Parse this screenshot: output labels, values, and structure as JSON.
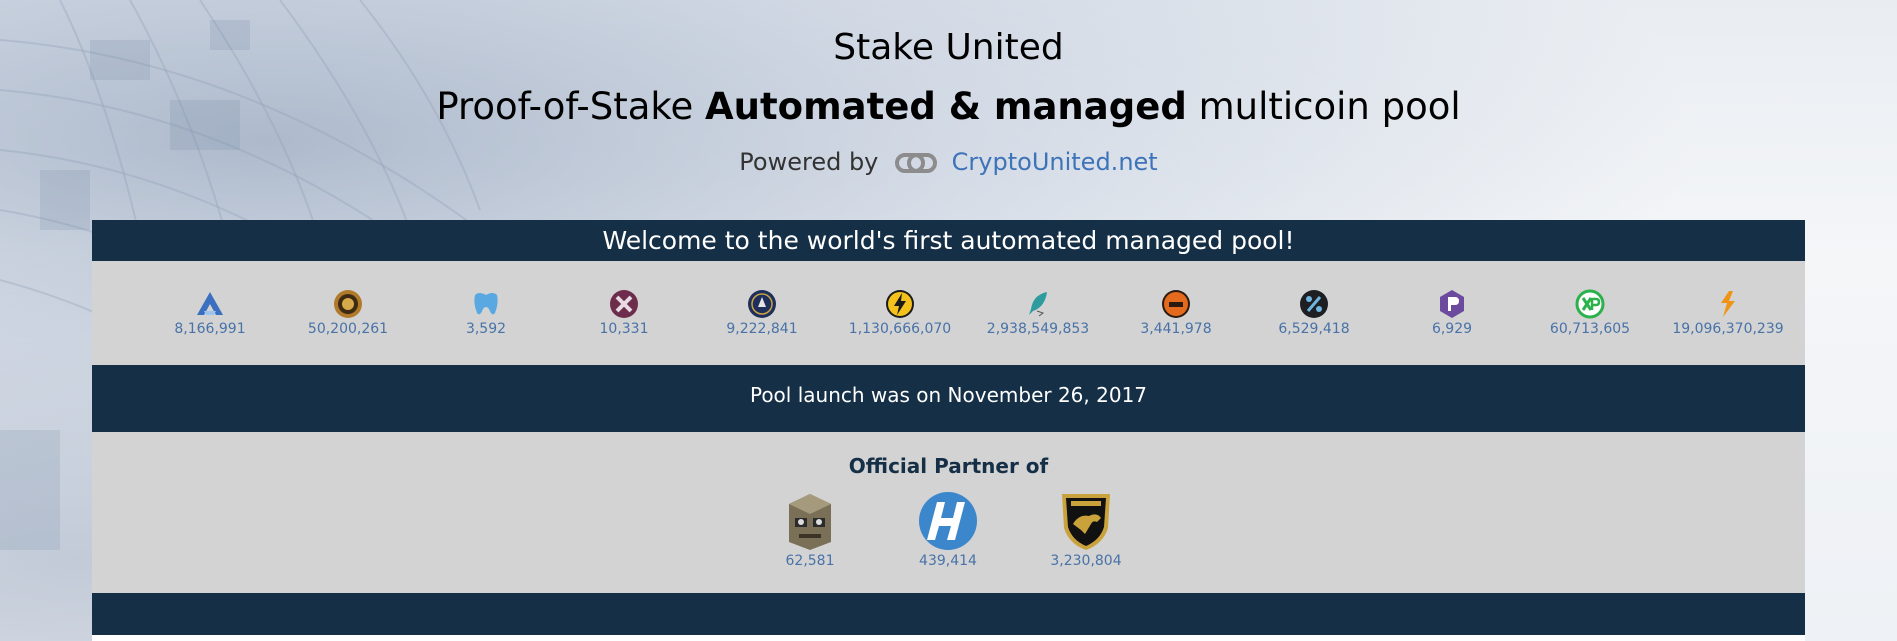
{
  "header": {
    "title": "Stake United",
    "tagline_prefix": "Proof-of-Stake ",
    "tagline_bold": "Automated & managed",
    "tagline_suffix": " multicoin pool",
    "powered_by": "Powered by",
    "powered_link": "CryptoUnited.net"
  },
  "welcome": "Welcome to the world's first automated managed pool!",
  "coins": [
    {
      "icon": "coin-blue-a-icon",
      "value": "8,166,991"
    },
    {
      "icon": "coin-gold-seal-icon",
      "value": "50,200,261"
    },
    {
      "icon": "coin-blue-tooth-icon",
      "value": "3,592"
    },
    {
      "icon": "coin-purple-x-icon",
      "value": "10,331"
    },
    {
      "icon": "coin-navy-emblem-icon",
      "value": "9,222,841"
    },
    {
      "icon": "coin-lightning-icon",
      "value": "1,130,666,070"
    },
    {
      "icon": "coin-feather-icon",
      "value": "2,938,549,853"
    },
    {
      "icon": "coin-orange-basket-icon",
      "value": "3,441,978"
    },
    {
      "icon": "coin-dark-percent-icon",
      "value": "6,529,418"
    },
    {
      "icon": "coin-purple-p-icon",
      "value": "6,929"
    },
    {
      "icon": "coin-green-xp-icon",
      "value": "60,713,605"
    },
    {
      "icon": "coin-orange-flame-icon",
      "value": "19,096,370,239"
    }
  ],
  "launch": "Pool launch was on November 26, 2017",
  "partners": {
    "heading": "Official Partner of",
    "items": [
      {
        "icon": "robot-head-icon",
        "value": "62,581"
      },
      {
        "icon": "blue-h-icon",
        "value": "439,414"
      },
      {
        "icon": "lamborghini-shield-icon",
        "value": "3,230,804"
      }
    ]
  }
}
